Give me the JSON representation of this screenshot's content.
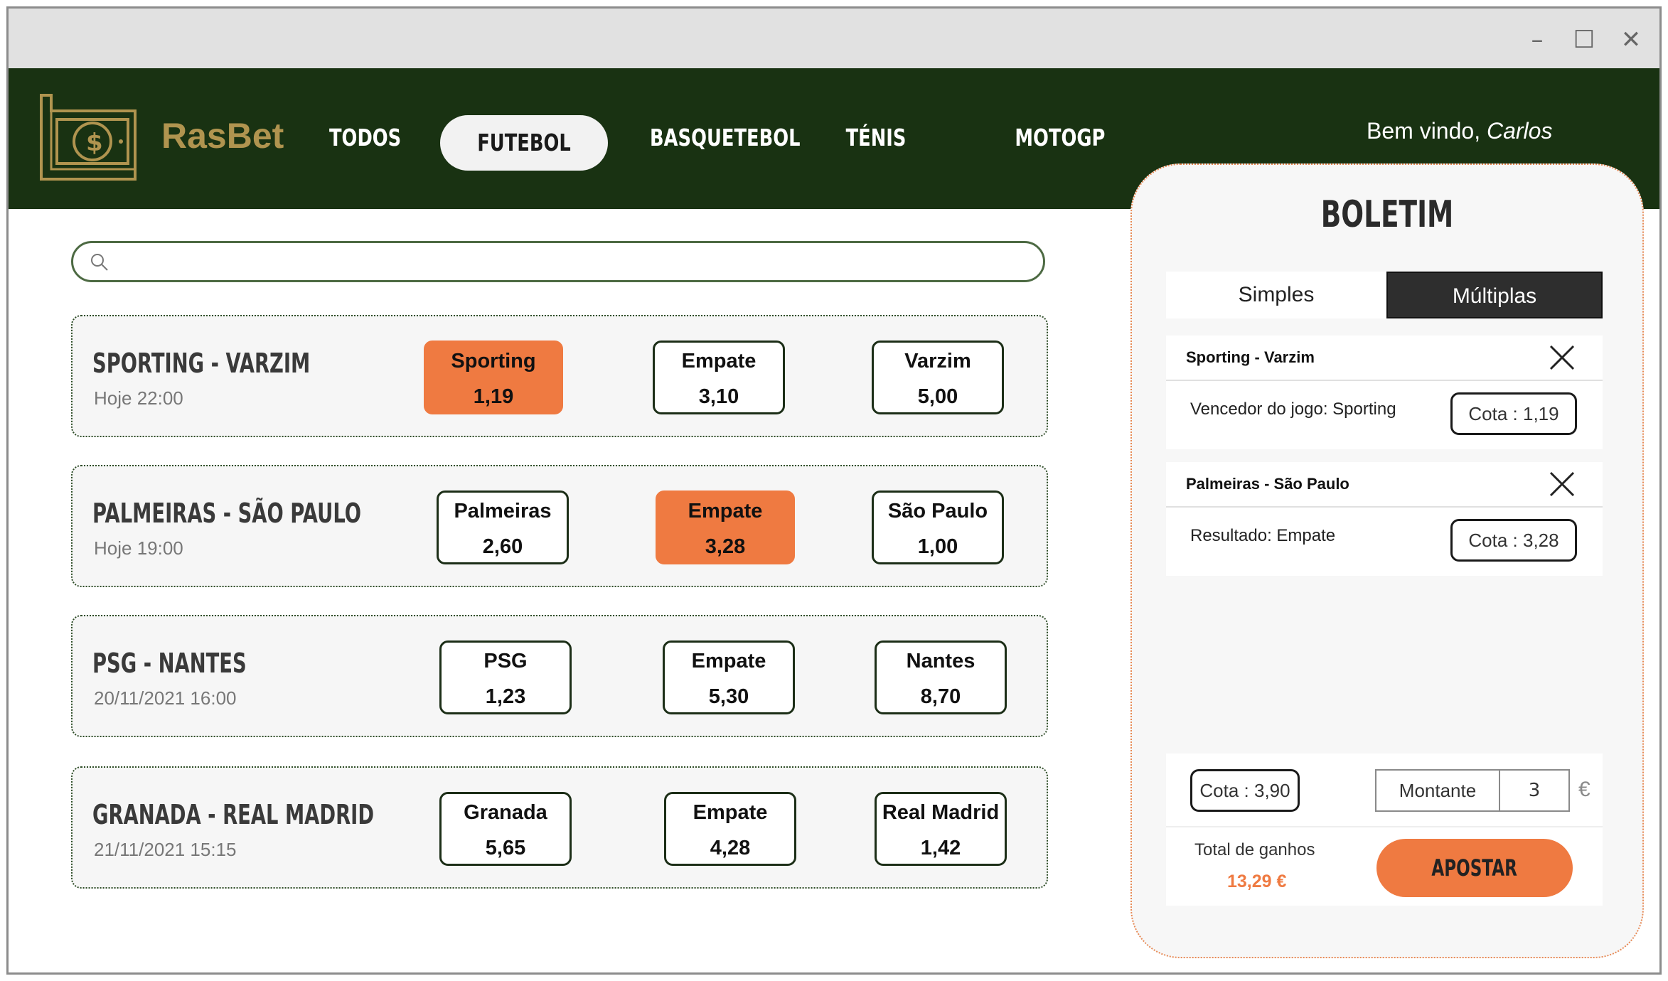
{
  "window": {
    "minimize": "–",
    "maximize": "☐",
    "close": "✕"
  },
  "brand": "RasBet",
  "nav": [
    "TODOS",
    "FUTEBOL",
    "BASQUETEBOL",
    "TÉNIS",
    "MOTOGP"
  ],
  "nav_active": "FUTEBOL",
  "welcome": {
    "prefix": "Bem vindo, ",
    "name": "Carlos"
  },
  "search": {
    "placeholder": ""
  },
  "matches": [
    {
      "teams": "SPORTING   -  VARZIM",
      "when": "Hoje 22:00",
      "odds": [
        {
          "label": "Sporting",
          "value": "1,19",
          "selected": true
        },
        {
          "label": "Empate",
          "value": "3,10"
        },
        {
          "label": "Varzim",
          "value": "5,00"
        }
      ]
    },
    {
      "teams": "PALMEIRAS  -  SÃO PAULO",
      "when": "Hoje 19:00",
      "odds": [
        {
          "label": "Palmeiras",
          "value": "2,60"
        },
        {
          "label": "Empate",
          "value": "3,28",
          "selected": true
        },
        {
          "label": "São Paulo",
          "value": "1,00"
        }
      ]
    },
    {
      "teams": "PSG  -  NANTES",
      "when": "20/11/2021 16:00",
      "odds": [
        {
          "label": "PSG",
          "value": "1,23"
        },
        {
          "label": "Empate",
          "value": "5,30"
        },
        {
          "label": "Nantes",
          "value": "8,70"
        }
      ]
    },
    {
      "teams": "GRANADA  -  REAL MADRID",
      "when": "21/11/2021 15:15",
      "odds": [
        {
          "label": "Granada",
          "value": "5,65"
        },
        {
          "label": "Empate",
          "value": "4,28"
        },
        {
          "label": "Real Madrid",
          "value": "1,42"
        }
      ]
    }
  ],
  "slip": {
    "title": "BOLETIM",
    "tabs": {
      "simples": "Simples",
      "multiplas": "Múltiplas"
    },
    "bets": [
      {
        "title": "Sporting - Varzim",
        "desc": "Vencedor do jogo: Sporting",
        "cota": "Cota : 1,19"
      },
      {
        "title": "Palmeiras - São Paulo",
        "desc": "Resultado:  Empate",
        "cota": "Cota : 3,28"
      }
    ],
    "total_cota": "Cota : 3,90",
    "montante_label": "Montante",
    "amount": "3",
    "currency": "€",
    "total_label": "Total de ganhos",
    "total_value": "13,29 €",
    "apostar": "APOSTAR"
  },
  "colors": {
    "header": "#193212",
    "accent": "#ef7a41",
    "gold": "#b0944f"
  }
}
